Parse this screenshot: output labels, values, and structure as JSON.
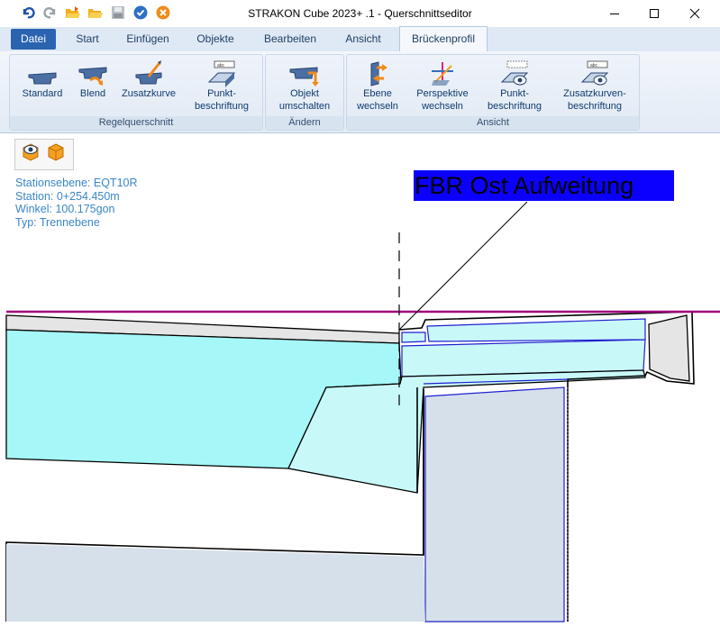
{
  "window": {
    "title": "STRAKON Cube 2023+ .1 - Querschnittseditor",
    "controls": [
      "minimize-icon",
      "maximize-icon",
      "close-icon"
    ]
  },
  "quick_access": [
    "undo-icon",
    "redo-icon",
    "open-folder-icon",
    "folder-icon",
    "save-icon",
    "confirm-icon",
    "cancel-icon"
  ],
  "tabs": [
    {
      "label": "Datei"
    },
    {
      "label": "Start"
    },
    {
      "label": "Einfügen"
    },
    {
      "label": "Objekte"
    },
    {
      "label": "Bearbeiten"
    },
    {
      "label": "Ansicht"
    },
    {
      "label": "Brückenprofil",
      "active": true
    }
  ],
  "ribbon": {
    "groups": [
      {
        "label": "Regelquerschnitt",
        "buttons": [
          {
            "label": "Standard",
            "icon": "standard-section-icon"
          },
          {
            "label": "Blend",
            "icon": "blend-section-icon"
          },
          {
            "label": "Zusatzkurve",
            "icon": "additional-curve-icon"
          },
          {
            "label_line1": "Punkt-",
            "label_line2": "beschriftung",
            "icon": "point-label-icon"
          }
        ]
      },
      {
        "label": "Ändern",
        "buttons": [
          {
            "label_line1": "Objekt",
            "label_line2": "umschalten",
            "icon": "switch-object-icon"
          }
        ]
      },
      {
        "label": "Ansicht",
        "buttons": [
          {
            "label_line1": "Ebene",
            "label_line2": "wechseln",
            "icon": "switch-plane-icon"
          },
          {
            "label_line1": "Perspektive",
            "label_line2": "wechseln",
            "icon": "switch-perspective-icon"
          },
          {
            "label_line1": "Punkt-",
            "label_line2": "beschriftung",
            "icon": "point-label-view-icon"
          },
          {
            "label_line1": "Zusatzkurven-",
            "label_line2": "beschriftung",
            "icon": "curve-label-view-icon"
          }
        ]
      }
    ]
  },
  "view_toolbar": [
    "visibility-cube-icon",
    "solid-cube-icon"
  ],
  "info": {
    "line1": "Stationsebene: EQT10R",
    "line2": "Station: 0+254.450m",
    "line3": "Winkel: 100.175gon",
    "line4": "Typ: Trennebene"
  },
  "annotation": {
    "label": "FBR Ost Aufweitung",
    "background": "#0b00ff"
  },
  "colors": {
    "profile_line": "#a0007f",
    "cyan_fill": "#a6f7f7",
    "light_cyan_fill": "#c9f8f8",
    "grey_fill": "#e5e5e5",
    "slate_fill": "#d6e0ea",
    "blue_outline": "#1f1fd0"
  }
}
